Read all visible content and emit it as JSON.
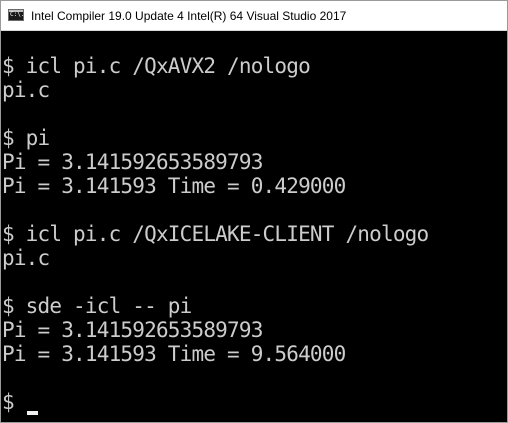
{
  "window": {
    "title": "Intel Compiler 19.0 Update 4 Intel(R) 64 Visual Studio 2017",
    "icon": "console-app-icon",
    "icon_glyph": "C:\\."
  },
  "console": {
    "lines": [
      "$ icl pi.c /QxAVX2 /nologo",
      "pi.c",
      "",
      "$ pi",
      "Pi = 3.141592653589793",
      "Pi = 3.141593 Time = 0.429000",
      "",
      "$ icl pi.c /QxICELAKE-CLIENT /nologo",
      "pi.c",
      "",
      "$ sde -icl -- pi",
      "Pi = 3.141592653589793",
      "Pi = 3.141593 Time = 9.564000",
      "",
      "$ "
    ],
    "text_color": "#cccccc",
    "background": "#000000"
  }
}
